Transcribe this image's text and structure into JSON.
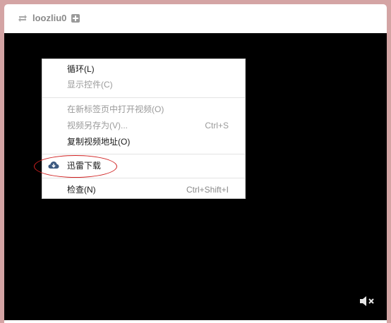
{
  "header": {
    "username": "loozliu0"
  },
  "context_menu": {
    "items": [
      {
        "label": "循环(L)",
        "shortcut": ""
      },
      {
        "label": "显示控件(C)",
        "shortcut": ""
      },
      {
        "label": "在新标签页中打开视频(O)",
        "shortcut": ""
      },
      {
        "label": "视频另存为(V)...",
        "shortcut": "Ctrl+S"
      },
      {
        "label": "复制视频地址(O)",
        "shortcut": ""
      },
      {
        "label": "迅雷下载",
        "shortcut": ""
      },
      {
        "label": "检查(N)",
        "shortcut": "Ctrl+Shift+I"
      }
    ]
  },
  "colors": {
    "video_bg": "#000000",
    "page_bg": "#d4a4a4",
    "highlight_ring": "#d02020"
  },
  "icons": [
    "repeat-icon",
    "add-icon",
    "cloud-download-icon",
    "volume-muted-icon"
  ]
}
